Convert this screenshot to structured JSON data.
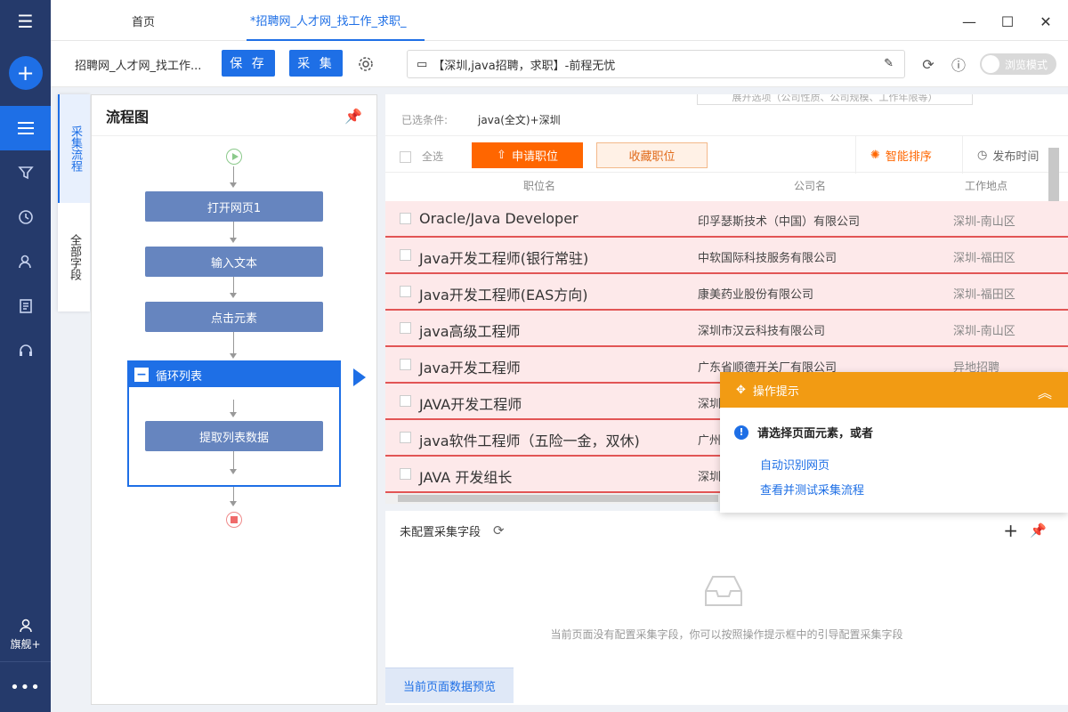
{
  "sidebar": {
    "user_label": "旗舰+"
  },
  "tabs": [
    {
      "label": "首页"
    },
    {
      "label": "*招聘网_人才网_找工作_求职_"
    }
  ],
  "toolbar": {
    "task_title": "招聘网_人才网_找工作...",
    "save_label": "保 存",
    "collect_label": "采 集",
    "url_text": "【深圳,java招聘，求职】-前程无忧",
    "browse_mode_label": "浏览模式"
  },
  "vtabs": {
    "flow_label": "采集流程",
    "fields_label": "全部字段"
  },
  "flow": {
    "title": "流程图",
    "nodes": [
      "打开网页1",
      "输入文本",
      "点击元素"
    ],
    "loop_label": "循环列表",
    "loop_inner": "提取列表数据"
  },
  "page": {
    "filter_hint": "展开选项（公司性质、公司规模、工作年限等）",
    "cond_label": "已选条件:",
    "cond_value": "java(全文)+深圳",
    "select_all": "全选",
    "apply_label": "申请职位",
    "fav_label": "收藏职位",
    "smart_sort": "智能排序",
    "pub_time": "发布时间",
    "col_position": "职位名",
    "col_company": "公司名",
    "col_location": "工作地点",
    "rows": [
      {
        "position": "Oracle/Java Developer",
        "company": "印孚瑟斯技术（中国）有限公司",
        "location": "深圳-南山区"
      },
      {
        "position": "Java开发工程师(银行常驻)",
        "company": "中软国际科技服务有限公司",
        "location": "深圳-福田区"
      },
      {
        "position": "Java开发工程师(EAS方向)",
        "company": "康美药业股份有限公司",
        "location": "深圳-福田区"
      },
      {
        "position": "java高级工程师",
        "company": "深圳市汉云科技有限公司",
        "location": "深圳-南山区"
      },
      {
        "position": "Java开发工程师",
        "company": "广东省顺德开关厂有限公司",
        "location": "异地招聘"
      },
      {
        "position": "JAVA开发工程师",
        "company": "深圳",
        "location": ""
      },
      {
        "position": "java软件工程师（五险一金，双休)",
        "company": "广州",
        "location": ""
      },
      {
        "position": "JAVA 开发组长",
        "company": "深圳",
        "location": ""
      }
    ]
  },
  "tip": {
    "title": "操作提示",
    "message": "请选择页面元素，或者",
    "link1": "自动识别网页",
    "link2": "查看并测试采集流程"
  },
  "fields": {
    "title": "未配置采集字段",
    "empty_msg": "当前页面没有配置采集字段，你可以按照操作提示框中的引导配置采集字段",
    "preview_tab": "当前页面数据预览"
  },
  "colors": {
    "sidebar_bg": "#253a6b",
    "accent_blue": "#1e6fe6",
    "node_blue": "#6685bf",
    "apply_orange": "#ff6600",
    "tip_orange": "#f29b13",
    "row_bg": "#fde9ea",
    "row_border": "#e25555"
  }
}
